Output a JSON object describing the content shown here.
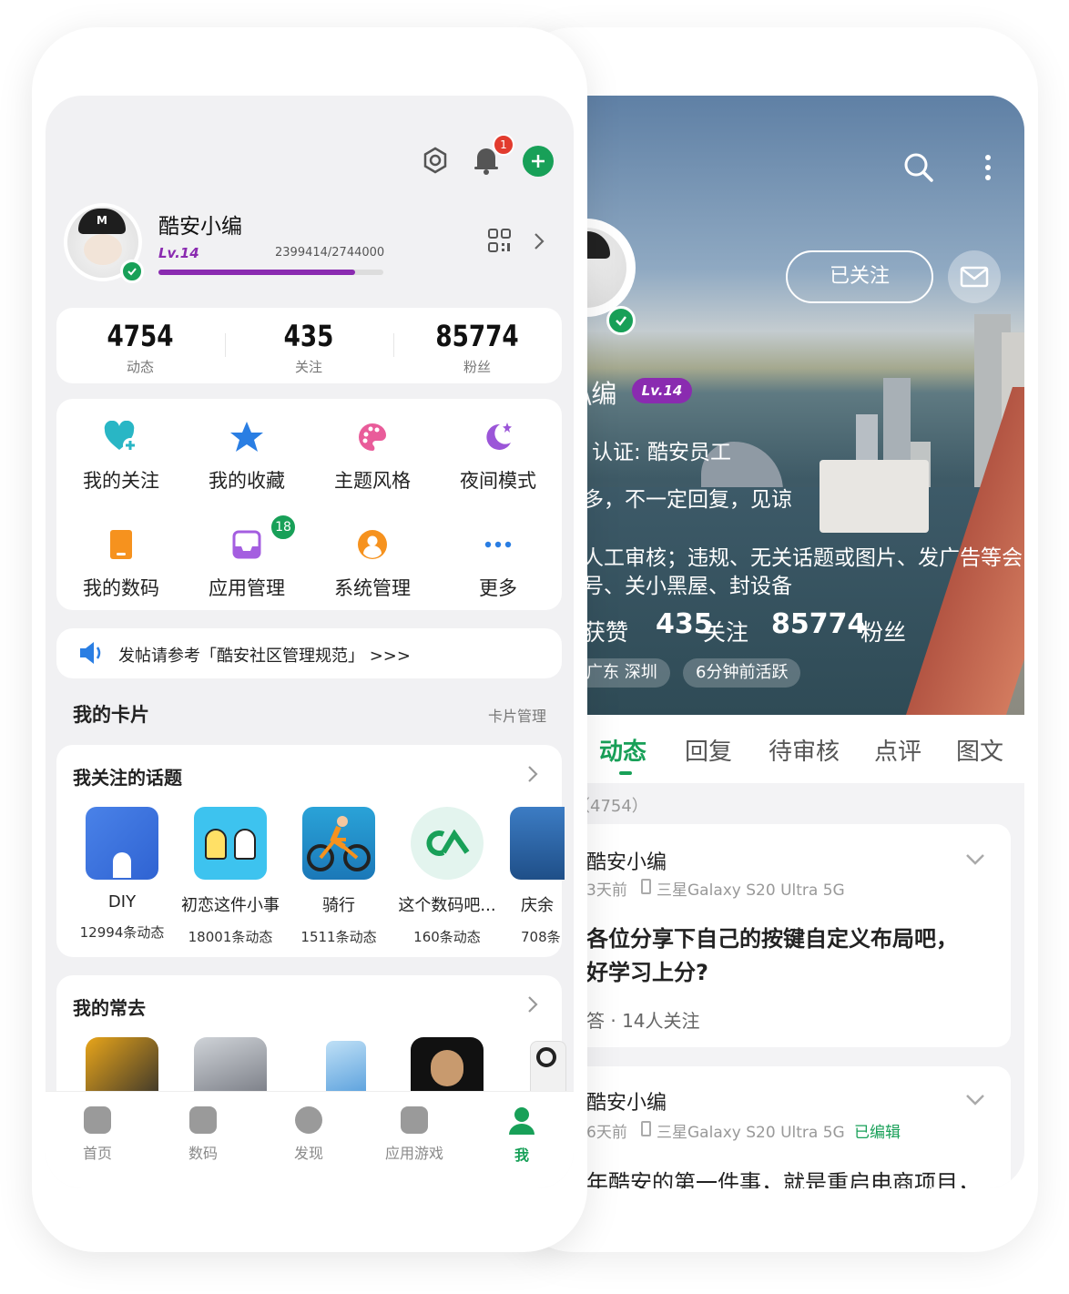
{
  "colors": {
    "accent": "#18a058",
    "level_purple": "#8a2bb0",
    "badge_red": "#e23b2e"
  },
  "me": {
    "username": "酷安小编",
    "level": "Lv.14",
    "exp": "2399414/2744000",
    "exp_progress": 0.874,
    "stats": [
      {
        "value": "4754",
        "label": "动态"
      },
      {
        "value": "435",
        "label": "关注"
      },
      {
        "value": "85774",
        "label": "粉丝"
      }
    ],
    "notification_count": "1",
    "grid": [
      {
        "label": "我的关注",
        "icon": "heart-plus-icon"
      },
      {
        "label": "我的收藏",
        "icon": "star-icon"
      },
      {
        "label": "主题风格",
        "icon": "palette-icon"
      },
      {
        "label": "夜间模式",
        "icon": "moon-icon"
      },
      {
        "label": "我的数码",
        "icon": "phone-icon"
      },
      {
        "label": "应用管理",
        "icon": "inbox-icon",
        "badge": "18"
      },
      {
        "label": "系统管理",
        "icon": "user-circle-icon"
      },
      {
        "label": "更多",
        "icon": "more-icon"
      }
    ],
    "notice": "发帖请参考「酷安社区管理规范」 >>>",
    "cards_title": "我的卡片",
    "cards_manage": "卡片管理",
    "topics_title": "我关注的话题",
    "topics": [
      {
        "name": "DIY",
        "count": "12994条动态"
      },
      {
        "name": "初恋这件小事",
        "count": "18001条动态"
      },
      {
        "name": "骑行",
        "count": "1511条动态"
      },
      {
        "name": "这个数码吧...",
        "count": "160条动态"
      },
      {
        "name": "庆余",
        "count": "708条"
      }
    ],
    "frequent_title": "我的常去",
    "nav": [
      {
        "label": "首页"
      },
      {
        "label": "数码"
      },
      {
        "label": "发现"
      },
      {
        "label": "应用游戏"
      },
      {
        "label": "我"
      }
    ]
  },
  "profile": {
    "follow_label": "已关注",
    "name_partial": "\\编",
    "level": "Lv.14",
    "verify": "认证: 酷安员工",
    "bio1": "多，不一定回复，见谅",
    "bio2": "人工审核；违规、无关话题或图片、发广告等会",
    "bio3": "号、关小黑屋、封设备",
    "likes_partial": "获赞",
    "follow_count": "435",
    "follow_word": "关注",
    "fans_count": "85774",
    "fans_word": "粉丝",
    "location": "广东 深圳",
    "active": "6分钟前活跃",
    "tabs": [
      "动态",
      "回复",
      "待审核",
      "点评",
      "图文"
    ],
    "count_line": "（4754）",
    "posts": [
      {
        "author": "酷安小编",
        "time": "3天前",
        "device": "三星Galaxy S20 Ultra 5G",
        "edited": "",
        "title1": "各位分享下自己的按键自定义布局吧，",
        "title2": "好学习上分?",
        "meta": "答 · 14人关注"
      },
      {
        "author": "酷安小编",
        "time": "6天前",
        "device": "三星Galaxy S20 Ultra 5G",
        "edited": "已编辑",
        "title1": "年酷安的第一件事，就是重启电商项目，",
        "title2": "",
        "meta": ""
      }
    ]
  }
}
